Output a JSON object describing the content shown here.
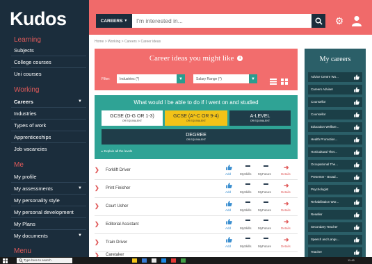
{
  "brand": {
    "logo": "Kudos"
  },
  "sidebar": {
    "sections": [
      {
        "title": "Learning",
        "items": [
          "Subjects",
          "College courses",
          "Uni courses"
        ]
      },
      {
        "title": "Working",
        "items": [
          "Careers",
          "Industries",
          "Types of work",
          "Apprenticeships",
          "Job vacancies"
        ]
      },
      {
        "title": "Me",
        "items": [
          "My profile",
          "My assessments",
          "My personality style",
          "My personal development",
          "My Plans",
          "My documents"
        ]
      },
      {
        "title": "Menu",
        "items": []
      }
    ]
  },
  "topbar": {
    "dropdown_label": "CAREERS",
    "search_placeholder": "I'm interested in...",
    "icons": [
      "search-icon",
      "gear-icon",
      "user-icon"
    ]
  },
  "breadcrumb": "Home > Working > Careers > Career ideas",
  "ideas": {
    "title": "Career ideas you might like",
    "filter_label": "Filter:",
    "industries_value": "Industries (*)",
    "salary_value": "Salary Range (*)"
  },
  "studied": {
    "title": "What would I be able to do if I went on and studied",
    "quals": [
      {
        "main": "GCSE (D-G OR 1-3)",
        "sub": "OR EQUIVALENT"
      },
      {
        "main": "GCSE (A*-C OR 9-4)",
        "sub": "OR EQUIVALENT"
      },
      {
        "main": "A-LEVEL",
        "sub": "OR EQUIVALENT"
      },
      {
        "main": "DEGREE",
        "sub": "OR EQUIVALENT"
      }
    ],
    "explain": "Explain all the levels"
  },
  "careers": {
    "rows": [
      "Forklift Driver",
      "Print Finisher",
      "Court Usher",
      "Editorial Assistant",
      "Train Driver",
      "Caretaker"
    ],
    "add_label": "Add",
    "myskills_label": "MySkills",
    "myfuture_label": "MyFuture",
    "details_label": "Details"
  },
  "my_careers": {
    "title": "My careers",
    "items": [
      "Advice Centre Wo...",
      "Careers Adviser",
      "Counsellor",
      "Counsellor",
      "Education Welfare...",
      "Health Promotion...",
      "Horticultural Ther...",
      "Occupational The...",
      "Presenter - Broad...",
      "Psychologist",
      "Rehabilitation Wor...",
      "Reseller",
      "Secondary Teacher",
      "Speech and Langu...",
      "Teacher"
    ]
  },
  "taskbar": {
    "search_text": "Type here to search",
    "time": "11:45"
  },
  "colors": {
    "sidebar": "#1b2d3c",
    "accent": "#f06a6a",
    "teal": "#2fa395",
    "panel": "#2b5f68",
    "yellow": "#f2c318"
  }
}
